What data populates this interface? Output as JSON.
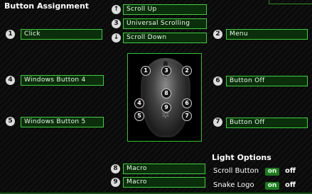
{
  "title": "Button Assignment",
  "buttons": {
    "scroll_up": {
      "icon": "up-arrow-icon",
      "badge": "↑",
      "label": "Scroll Up"
    },
    "universal_scrolling": {
      "badge": "3",
      "label": "Universal Scrolling"
    },
    "scroll_down": {
      "icon": "down-arrow-icon",
      "badge": "↓",
      "label": "Scroll Down"
    },
    "b1": {
      "badge": "1",
      "label": "Click"
    },
    "b2": {
      "badge": "2",
      "label": "Menu"
    },
    "b4": {
      "badge": "4",
      "label": "Windows Button 4"
    },
    "b5": {
      "badge": "5",
      "label": "Windows Button 5"
    },
    "b6": {
      "badge": "6",
      "label": "Button Off"
    },
    "b7": {
      "badge": "7",
      "label": "Button Off"
    },
    "b8": {
      "badge": "8",
      "label": "Macro"
    },
    "b9": {
      "badge": "9",
      "label": "Macro"
    }
  },
  "mouse_markers": [
    "1",
    "3",
    "2",
    "8",
    "4",
    "9",
    "6",
    "5",
    "7"
  ],
  "light_options": {
    "title": "Light Options",
    "scroll_button": {
      "label": "Scroll Button",
      "on": "on",
      "off": "off"
    },
    "snake_logo": {
      "label": "Snake Logo",
      "on": "on",
      "off": "off"
    }
  },
  "colors": {
    "accent": "#3fd03f",
    "field_bg": "#0b2e0b",
    "on_bg": "#1e7a1e"
  }
}
